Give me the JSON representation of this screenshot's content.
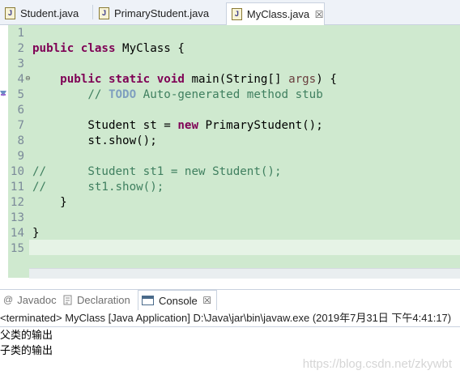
{
  "editor_tabs": [
    {
      "label": "Student.java",
      "active": false
    },
    {
      "label": "PrimaryStudent.java",
      "active": false
    },
    {
      "label": "MyClass.java",
      "active": true
    }
  ],
  "close_glyph": "☒",
  "code_lines": [
    {
      "n": "1",
      "tokens": []
    },
    {
      "n": "2",
      "tokens": [
        {
          "t": "public",
          "c": "kw"
        },
        {
          "t": " "
        },
        {
          "t": "class",
          "c": "kw"
        },
        {
          "t": " MyClass {"
        }
      ]
    },
    {
      "n": "3",
      "tokens": []
    },
    {
      "n": "4",
      "tokens": [
        {
          "t": "    "
        },
        {
          "t": "public",
          "c": "kw"
        },
        {
          "t": " "
        },
        {
          "t": "static",
          "c": "kw"
        },
        {
          "t": " "
        },
        {
          "t": "void",
          "c": "kw"
        },
        {
          "t": " main(String[] "
        },
        {
          "t": "args",
          "c": "param"
        },
        {
          "t": ") {"
        }
      ]
    },
    {
      "n": "5",
      "tokens": [
        {
          "t": "        "
        },
        {
          "t": "// ",
          "c": "cm"
        },
        {
          "t": "TODO",
          "c": "todo"
        },
        {
          "t": " Auto-generated method stub",
          "c": "cm"
        }
      ]
    },
    {
      "n": "6",
      "tokens": []
    },
    {
      "n": "7",
      "tokens": [
        {
          "t": "        Student st = "
        },
        {
          "t": "new",
          "c": "kw"
        },
        {
          "t": " PrimaryStudent();"
        }
      ]
    },
    {
      "n": "8",
      "tokens": [
        {
          "t": "        st.show();"
        }
      ]
    },
    {
      "n": "9",
      "tokens": []
    },
    {
      "n": "10",
      "tokens": [
        {
          "t": "//      Student st1 = new Student();",
          "c": "cm"
        }
      ]
    },
    {
      "n": "11",
      "tokens": [
        {
          "t": "//      st1.show();",
          "c": "cm"
        }
      ]
    },
    {
      "n": "12",
      "tokens": [
        {
          "t": "    }"
        }
      ]
    },
    {
      "n": "13",
      "tokens": []
    },
    {
      "n": "14",
      "tokens": [
        {
          "t": "}"
        }
      ]
    },
    {
      "n": "15",
      "tokens": []
    }
  ],
  "panel_tabs": [
    {
      "label": "Javadoc",
      "icon": "@",
      "active": false
    },
    {
      "label": "Declaration",
      "icon": "declaration-icon",
      "active": false
    },
    {
      "label": "Console",
      "icon": "console-icon",
      "active": true
    }
  ],
  "console": {
    "header": "<terminated> MyClass [Java Application] D:\\Java\\jar\\bin\\javaw.exe (2019年7月31日 下午4:41:17)",
    "output": [
      "父类的输出",
      "子类的输出"
    ]
  },
  "watermark": "https://blog.csdn.net/zkywbt",
  "colors": {
    "keyword": "#7f0055",
    "comment": "#3f7f5f",
    "todo": "#7f9fbf",
    "param": "#6a3e3e",
    "editor_bg": "#cfe9cf"
  }
}
